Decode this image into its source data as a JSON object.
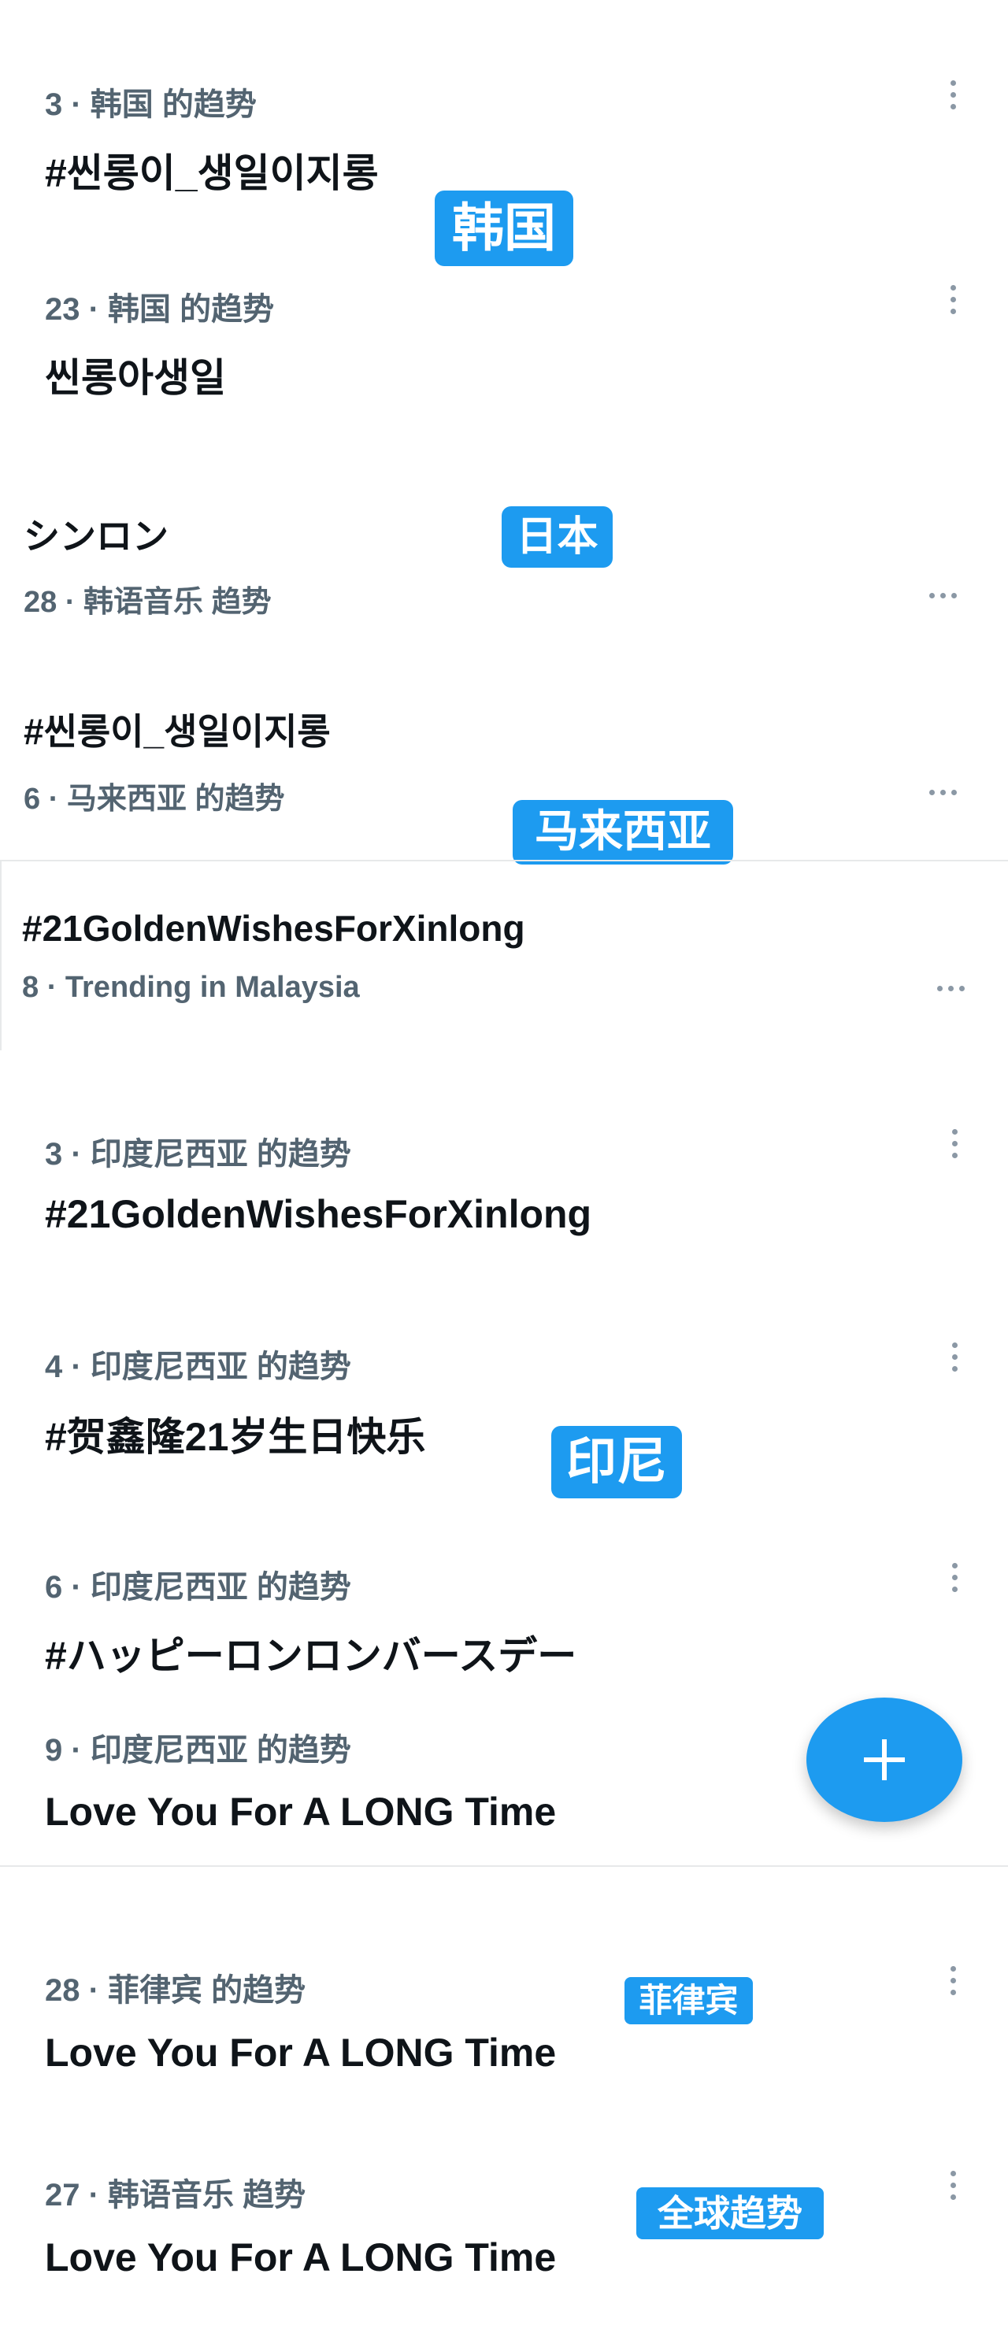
{
  "section_korea": {
    "badge": "韩国",
    "items": [
      {
        "meta": "3 · 韩国 的趋势",
        "title": "#씬롱이_생일이지롱"
      },
      {
        "meta": "23 · 韩国 的趋势",
        "title": "씬롱아생일"
      }
    ]
  },
  "section_japan": {
    "badge": "日本",
    "items": [
      {
        "title": "シンロン",
        "meta": "28 · 韩语音乐 趋势"
      }
    ]
  },
  "section_malaysia": {
    "badge": "马来西亚",
    "items": [
      {
        "title": "#씬롱이_생일이지롱",
        "meta": "6 · 马来西亚 的趋势"
      },
      {
        "title": "#21GoldenWishesForXinlong",
        "meta": "8 · Trending in Malaysia"
      }
    ]
  },
  "section_indonesia": {
    "badge": "印尼",
    "items": [
      {
        "meta": "3 · 印度尼西亚 的趋势",
        "title": "#21GoldenWishesForXinlong"
      },
      {
        "meta": "4 · 印度尼西亚 的趋势",
        "title": "#贺鑫隆21岁生日快乐"
      },
      {
        "meta": "6 · 印度尼西亚 的趋势",
        "title": "#ハッピーロンロンバースデー"
      },
      {
        "meta": "9 · 印度尼西亚 的趋势",
        "title": "Love You For A LONG Time"
      }
    ]
  },
  "section_philippines": {
    "badge": "菲律宾",
    "items": [
      {
        "meta": "28 · 菲律宾 的趋势",
        "title": "Love You For A LONG Time"
      }
    ]
  },
  "section_global": {
    "badge": "全球趋势",
    "items": [
      {
        "meta": "27 · 韩语音乐 趋势",
        "title": "Love You For A LONG Time"
      }
    ]
  },
  "fab": {
    "icon": "plus-icon"
  },
  "colors": {
    "accent": "#1d9bf0",
    "meta_text": "#536471",
    "title_text": "#0f1419"
  }
}
